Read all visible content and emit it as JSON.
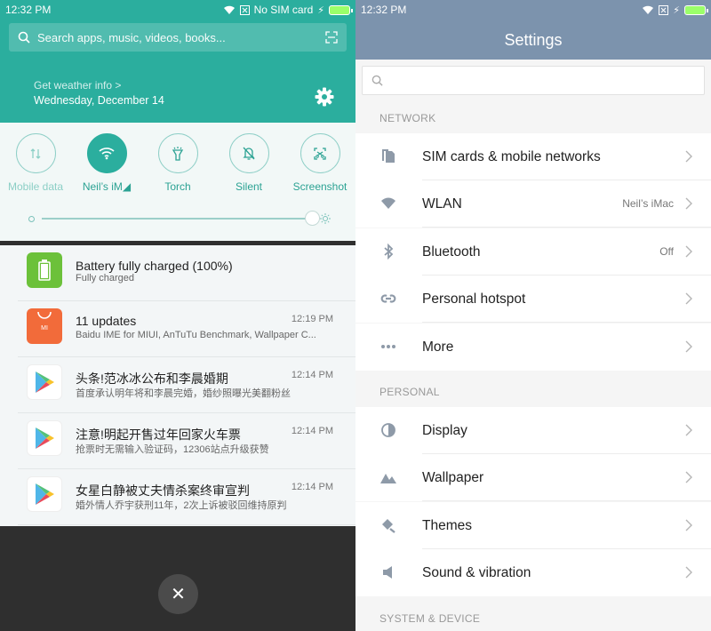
{
  "left": {
    "status": {
      "time": "12:32 PM",
      "no_sim": "No SIM card"
    },
    "search": {
      "placeholder": "Search apps, music, videos, books..."
    },
    "weather": {
      "link": "Get weather info >",
      "date": "Wednesday, December 14"
    },
    "tiles": [
      {
        "label": "Mobile data",
        "icon": "mobile-data-icon",
        "state": "off-dim"
      },
      {
        "label": "Neil’s iM◢",
        "icon": "wifi-icon",
        "state": "on"
      },
      {
        "label": "Torch",
        "icon": "torch-icon",
        "state": "off"
      },
      {
        "label": "Silent",
        "icon": "silent-icon",
        "state": "off"
      },
      {
        "label": "Screenshot",
        "icon": "screenshot-icon",
        "state": "off"
      }
    ],
    "brightness_level": 1.0,
    "notifications": [
      {
        "title": "Battery fully charged (100%)",
        "subtitle": "Fully charged",
        "time": "",
        "icon": "battery-app-icon",
        "color": "#6cc13a"
      },
      {
        "title": "11 updates",
        "subtitle": "Baidu IME for MIUI, AnTuTu Benchmark, Wallpaper C...",
        "time": "12:19 PM",
        "icon": "mi-store-icon",
        "color": "#f26b3a",
        "icon_text": "MI"
      },
      {
        "title": "头条!范冰冰公布和李晨婚期",
        "subtitle": "首度承认明年将和李晨完婚，婚纱照曝光美翻粉丝",
        "time": "12:14 PM",
        "icon": "play-store-icon",
        "color": "#ffffff"
      },
      {
        "title": "注意!明起开售过年回家火车票",
        "subtitle": "抢票时无需输入验证码，12306站点升级获赞",
        "time": "12:14 PM",
        "icon": "play-store-icon",
        "color": "#ffffff"
      },
      {
        "title": "女星白静被丈夫情杀案终审宣判",
        "subtitle": "婚外情人乔宇获刑11年，2次上诉被驳回维持原判",
        "time": "12:14 PM",
        "icon": "play-store-icon",
        "color": "#ffffff"
      }
    ],
    "close_glyph": "✕"
  },
  "right": {
    "status": {
      "time": "12:32 PM"
    },
    "title": "Settings",
    "sections": [
      {
        "label": "NETWORK",
        "items": [
          {
            "label": "SIM cards & mobile networks",
            "value": "",
            "icon": "sim-icon"
          },
          {
            "label": "WLAN",
            "value": "Neil’s iMac",
            "icon": "wifi-icon"
          },
          {
            "label": "Bluetooth",
            "value": "Off",
            "icon": "bluetooth-icon"
          },
          {
            "label": "Personal hotspot",
            "value": "",
            "icon": "hotspot-icon"
          },
          {
            "label": "More",
            "value": "",
            "icon": "more-icon"
          }
        ]
      },
      {
        "label": "PERSONAL",
        "items": [
          {
            "label": "Display",
            "value": "",
            "icon": "display-icon"
          },
          {
            "label": "Wallpaper",
            "value": "",
            "icon": "wallpaper-icon"
          },
          {
            "label": "Themes",
            "value": "",
            "icon": "themes-icon"
          },
          {
            "label": "Sound & vibration",
            "value": "",
            "icon": "sound-icon"
          }
        ]
      },
      {
        "label": "SYSTEM & DEVICE",
        "items": []
      }
    ]
  },
  "colors": {
    "teal": "#2bae9e",
    "header_blue": "#7c93ad",
    "icon_gray": "#8e9aa8"
  }
}
